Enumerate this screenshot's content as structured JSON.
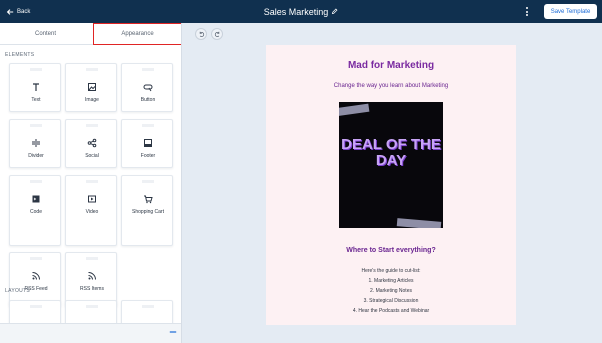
{
  "header": {
    "back_label": "Back",
    "title": "Sales Marketing",
    "save_label": "Save Template"
  },
  "tabs": [
    {
      "label": "Content"
    },
    {
      "label": "Appearance"
    }
  ],
  "sections": {
    "elements_label": "ELEMENTS",
    "layouts_label": "LAYOUTS"
  },
  "elements": [
    {
      "label": "Text",
      "icon": "text-icon"
    },
    {
      "label": "Image",
      "icon": "image-icon"
    },
    {
      "label": "Button",
      "icon": "button-icon"
    },
    {
      "label": "Divider",
      "icon": "divider-icon"
    },
    {
      "label": "Social",
      "icon": "social-icon"
    },
    {
      "label": "Footer",
      "icon": "footer-icon"
    },
    {
      "label": "Code",
      "icon": "code-icon"
    },
    {
      "label": "Video",
      "icon": "video-icon"
    },
    {
      "label": "Shopping Cart",
      "icon": "cart-icon"
    },
    {
      "label": "RSS Feed",
      "icon": "rss-icon"
    },
    {
      "label": "RSS Items",
      "icon": "rss-icon"
    }
  ],
  "email": {
    "heading": "Mad for Marketing",
    "subheading": "Change the way you learn about Marketing",
    "promo_text": "DEAL OF THE DAY",
    "section_heading": "Where to Start everything?",
    "lines": [
      "Here's the guide to cut-list:",
      "1. Marketing Articles",
      "2. Marketing Notes",
      "3. Strategical Discussion",
      "4. Hear the Podcasts and Webinar"
    ]
  },
  "colors": {
    "topbar": "#10304f",
    "accent": "#1b6ad6",
    "heading": "#7a2aa0",
    "highlight_border": "#e02424"
  }
}
